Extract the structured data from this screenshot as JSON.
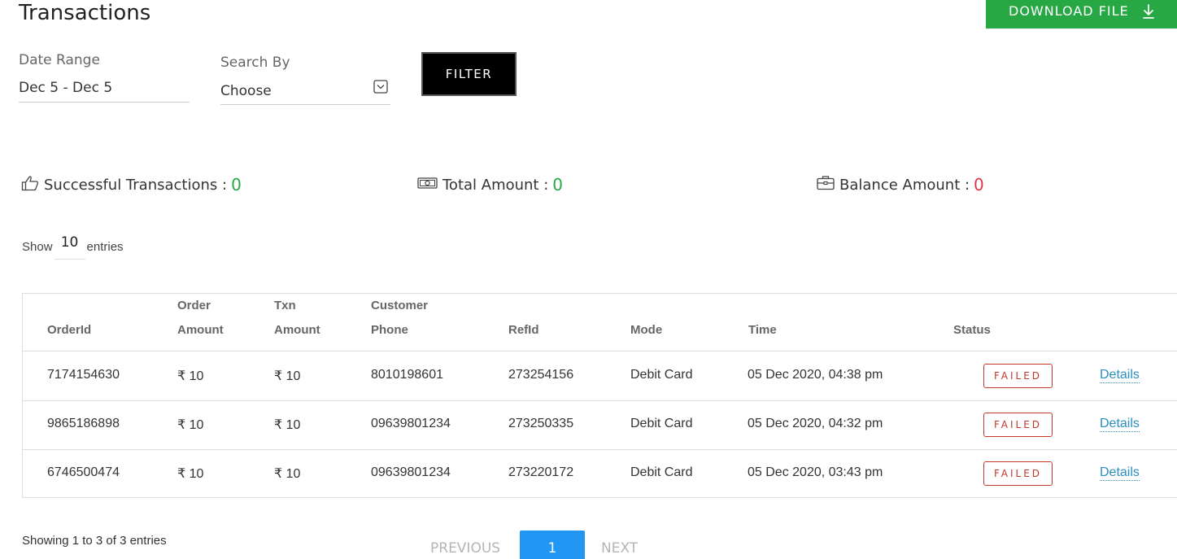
{
  "header": {
    "title": "Transactions",
    "download_label": "DOWNLOAD FILE"
  },
  "filters": {
    "date_range_label": "Date Range",
    "date_range_value": "Dec 5 - Dec 5",
    "search_by_label": "Search By",
    "search_by_value": "Choose",
    "filter_label": "FILTER"
  },
  "stats": {
    "successful_label": "Successful Transactions :",
    "successful_value": "0",
    "total_label": "Total Amount :",
    "total_value": "0",
    "balance_label": "Balance Amount :",
    "balance_value": "0"
  },
  "entries": {
    "show_label": "Show",
    "count": "10",
    "entries_label": "entries"
  },
  "table": {
    "headers": {
      "order_id": "OrderId",
      "order_amount_1": "Order",
      "order_amount_2": "Amount",
      "txn_amount_1": "Txn",
      "txn_amount_2": "Amount",
      "customer_phone_1": "Customer",
      "customer_phone_2": "Phone",
      "ref_id": "RefId",
      "mode": "Mode",
      "time": "Time",
      "status": "Status"
    },
    "rows": [
      {
        "order_id": "7174154630",
        "order_amount": "₹ 10",
        "txn_amount": "₹ 10",
        "phone": "8010198601",
        "ref_id": "273254156",
        "mode": "Debit Card",
        "time": "05 Dec 2020, 04:38 pm",
        "status": "FAILED",
        "details": "Details"
      },
      {
        "order_id": "9865186898",
        "order_amount": "₹ 10",
        "txn_amount": "₹ 10",
        "phone": "09639801234",
        "ref_id": "273250335",
        "mode": "Debit Card",
        "time": "05 Dec 2020, 04:32 pm",
        "status": "FAILED",
        "details": "Details"
      },
      {
        "order_id": "6746500474",
        "order_amount": "₹ 10",
        "txn_amount": "₹ 10",
        "phone": "09639801234",
        "ref_id": "273220172",
        "mode": "Debit Card",
        "time": "05 Dec 2020, 03:43 pm",
        "status": "FAILED",
        "details": "Details"
      }
    ]
  },
  "footer": {
    "showing": "Showing 1 to 3 of 3 entries",
    "previous": "PREVIOUS",
    "current_page": "1",
    "next": "NEXT"
  },
  "colors": {
    "download_button": "#28a745",
    "success_value": "#28a745",
    "balance_value": "#dc3545",
    "failed_badge": "#c0392b",
    "link": "#2a8fbd",
    "current_page": "#2196f3"
  },
  "icons": {
    "download": "download-icon",
    "select": "chevron-down-icon",
    "successful": "thumbs-up-icon",
    "total": "banknote-icon",
    "balance": "briefcase-icon"
  }
}
